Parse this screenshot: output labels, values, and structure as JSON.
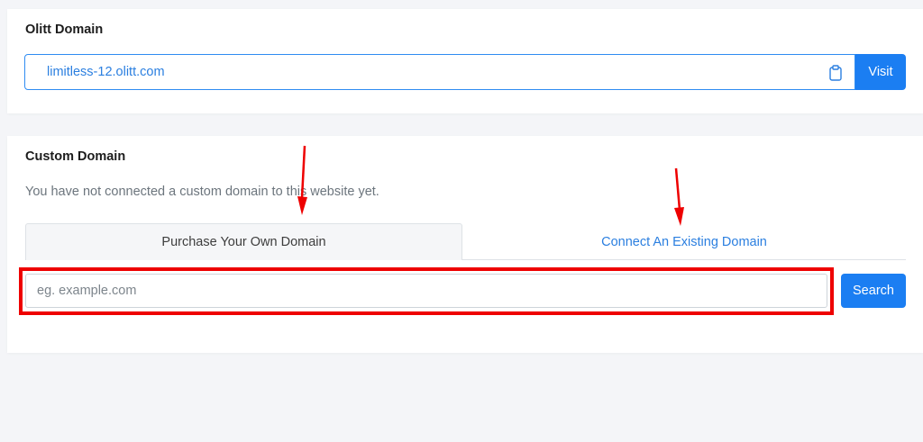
{
  "olitt_domain": {
    "title": "Olitt Domain",
    "domain_value": "limitless-12.olitt.com",
    "clipboard_icon": "clipboard-icon",
    "visit_label": "Visit"
  },
  "custom_domain": {
    "title": "Custom Domain",
    "status_text": "You have not connected a custom domain to this website yet.",
    "tabs": [
      {
        "label": "Purchase Your Own Domain",
        "active": true
      },
      {
        "label": "Connect An Existing Domain",
        "active": false
      }
    ],
    "search": {
      "placeholder": "eg. example.com",
      "value": "",
      "button_label": "Search"
    }
  },
  "annotations": {
    "arrow_icon": "red-arrow-icon",
    "highlight_color": "#ee0000"
  },
  "colors": {
    "accent": "#1b7ef2",
    "link": "#2b7fe0",
    "muted_text": "#6c757d",
    "page_background": "#f4f5f8"
  }
}
